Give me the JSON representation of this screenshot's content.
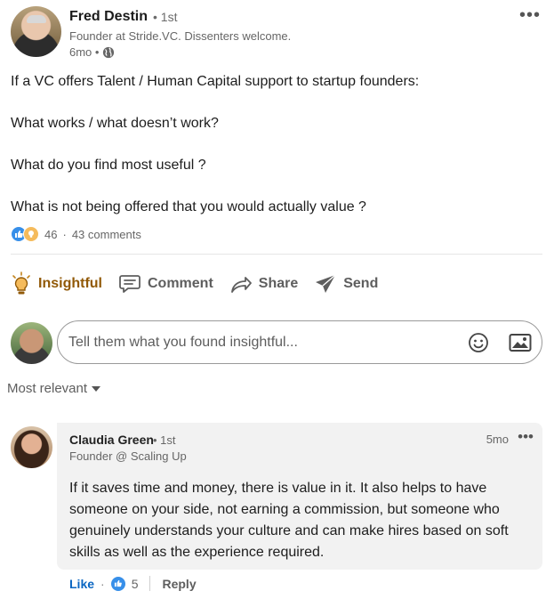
{
  "post": {
    "author": {
      "name": "Fred Destin",
      "degree": "• 1st",
      "headline": "Founder at Stride.VC. Dissenters welcome.",
      "time": "6mo •"
    },
    "more_icon": "more-horizontal-icon",
    "body": {
      "line1": "If a VC offers Talent / Human Capital support to startup founders:",
      "line2": "What works / what doesn’t work?",
      "line3": "What do you find most useful ?",
      "line4": "What is not being offered that you would actually value ?"
    },
    "reactions": {
      "icons": [
        "like-icon",
        "insightful-icon"
      ],
      "count": "46",
      "separator": "·",
      "comments": "43 comments"
    }
  },
  "actions": {
    "insightful": "Insightful",
    "comment": "Comment",
    "share": "Share",
    "send": "Send"
  },
  "composer": {
    "placeholder": "Tell them what you found insightful...",
    "value": ""
  },
  "sort": {
    "label": "Most relevant"
  },
  "comment": {
    "name": "Claudia Green",
    "degree": "• 1st",
    "headline": "Founder @ Scaling Up",
    "time": "5mo",
    "more": "•••",
    "text": "If it saves time and money, there is value in it. It also helps to have someone on your side, not earning a commission, but someone who genuinely understands your culture and can make hires based on soft skills as well as the experience required.",
    "like_label": "Like",
    "like_separator": "·",
    "like_count": "5",
    "reply_label": "Reply"
  },
  "colors": {
    "accent_insightful": "#915907",
    "link_blue": "#0a66c2",
    "like_blue": "#378fe9",
    "insight_yellow": "#f5bb5c"
  }
}
